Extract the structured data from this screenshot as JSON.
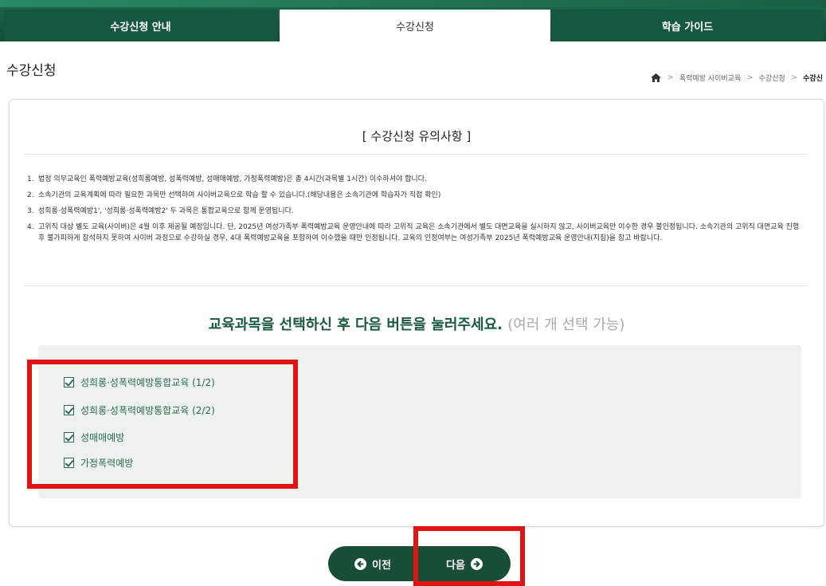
{
  "tabs": [
    {
      "label": "수강신청 안내"
    },
    {
      "label": "수강신청"
    },
    {
      "label": "학습 가이드"
    }
  ],
  "page_title": "수강신청",
  "breadcrumb": {
    "items": [
      "폭력예방 사이버교육",
      "수강신청",
      "수강신"
    ]
  },
  "notice": {
    "title": "[ 수강신청 유의사항 ]",
    "items": [
      {
        "num": "1.",
        "text": "법정 의무교육인 폭력예방교육(성희롱예방, 성폭력예방, 성매매예방, 가정폭력예방)은 총 4시간(과목별 1시간) 이수하셔야 합니다."
      },
      {
        "num": "2.",
        "text": "소속기관의 교육계획에 따라 필요한 과목만 선택하여 사이버교육으로 학습 할 수 있습니다.(해당내용은 소속기관에 학습자가 직접 확인)"
      },
      {
        "num": "3.",
        "text": "성희롱·성폭력예방1', '성희롱·성폭력예방2' 두 과목은 통합교육으로 함께 운영됩니다."
      },
      {
        "num": "4.",
        "text": "고위직 대상 별도 교육(사이버)은 4월 이후 제공될 예정입니다. 단, 2025년 여성가족부 폭력예방교육 운영안내에 따라 고위직 교육은 소속기관에서 별도 대면교육을 실시하지 않고, 사이버교육만 이수한 경우 불인정됩니다. 소속기관의 고위직 대면교육 진행 후 불가피하게 참석하지 못하여 사이버 과정으로 수강하실 경우, 4대 폭력예방교육을 포함하여 이수했을 때만 인정됩니다. 교육의 인정여부는 여성가족부 2025년 폭력예방교육 운영안내(지침)을 참고 바랍니다."
      }
    ]
  },
  "instruction": {
    "main": "교육과목을 선택하신 후 다음 버튼을 눌러주세요.",
    "hint": "(여러 개 선택 가능)"
  },
  "options": [
    {
      "label": "성희롱·성폭력예방통합교육 (1/2)",
      "checked": true
    },
    {
      "label": "성희롱·성폭력예방통합교육 (2/2)",
      "checked": true
    },
    {
      "label": "성매매예방",
      "checked": true
    },
    {
      "label": "가정폭력예방",
      "checked": true
    }
  ],
  "buttons": {
    "prev_label": "이전",
    "next_label": "다음"
  },
  "colors": {
    "brand_green": "#15583d",
    "highlight_red": "#e11414",
    "option_bg": "#eef2ee"
  }
}
